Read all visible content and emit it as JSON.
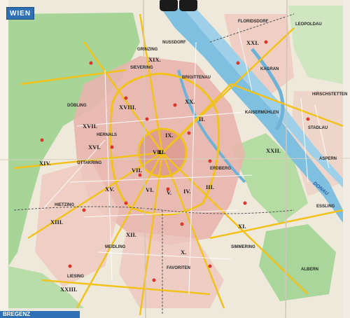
{
  "map": {
    "title": "WIEN",
    "footer_partial": "BREGENZ",
    "colors": {
      "paper": "#e9e4d6",
      "urban": "#e7b8b0",
      "greenery": "#9dcf8e",
      "water": "#7fbfdf",
      "road_major": "#f2c21c",
      "road_minor": "#ffffff",
      "title_blue": "#2f6fb3"
    },
    "districts": [
      "I.",
      "II.",
      "III.",
      "IV.",
      "V.",
      "VI.",
      "VII.",
      "VIII.",
      "IX.",
      "X.",
      "XI.",
      "XII.",
      "XIII.",
      "XIV.",
      "XV.",
      "XVI.",
      "XVII.",
      "XVIII.",
      "XIX.",
      "XX.",
      "XXI.",
      "XXII.",
      "XXIII."
    ],
    "places": [
      "NUSSDORF",
      "GRINZING",
      "SIEVERING",
      "DÖBLING",
      "KAISERMÜHLEN",
      "ERDBERG",
      "SIMMERING",
      "MEIDLING",
      "HIETZING",
      "OTTAKRING",
      "HERNALS",
      "LIESING",
      "FAVORITEN",
      "BRIGITTENAU",
      "FLORIDSDORF",
      "LEOPOLDAU",
      "STADLAU",
      "HIRSCHSTETTEN",
      "KAGRAN",
      "ASPERN",
      "ESSLING",
      "ALBERN"
    ],
    "river": "DONAU",
    "icons": [
      "map-clip-icon",
      "map-clip-icon"
    ]
  }
}
